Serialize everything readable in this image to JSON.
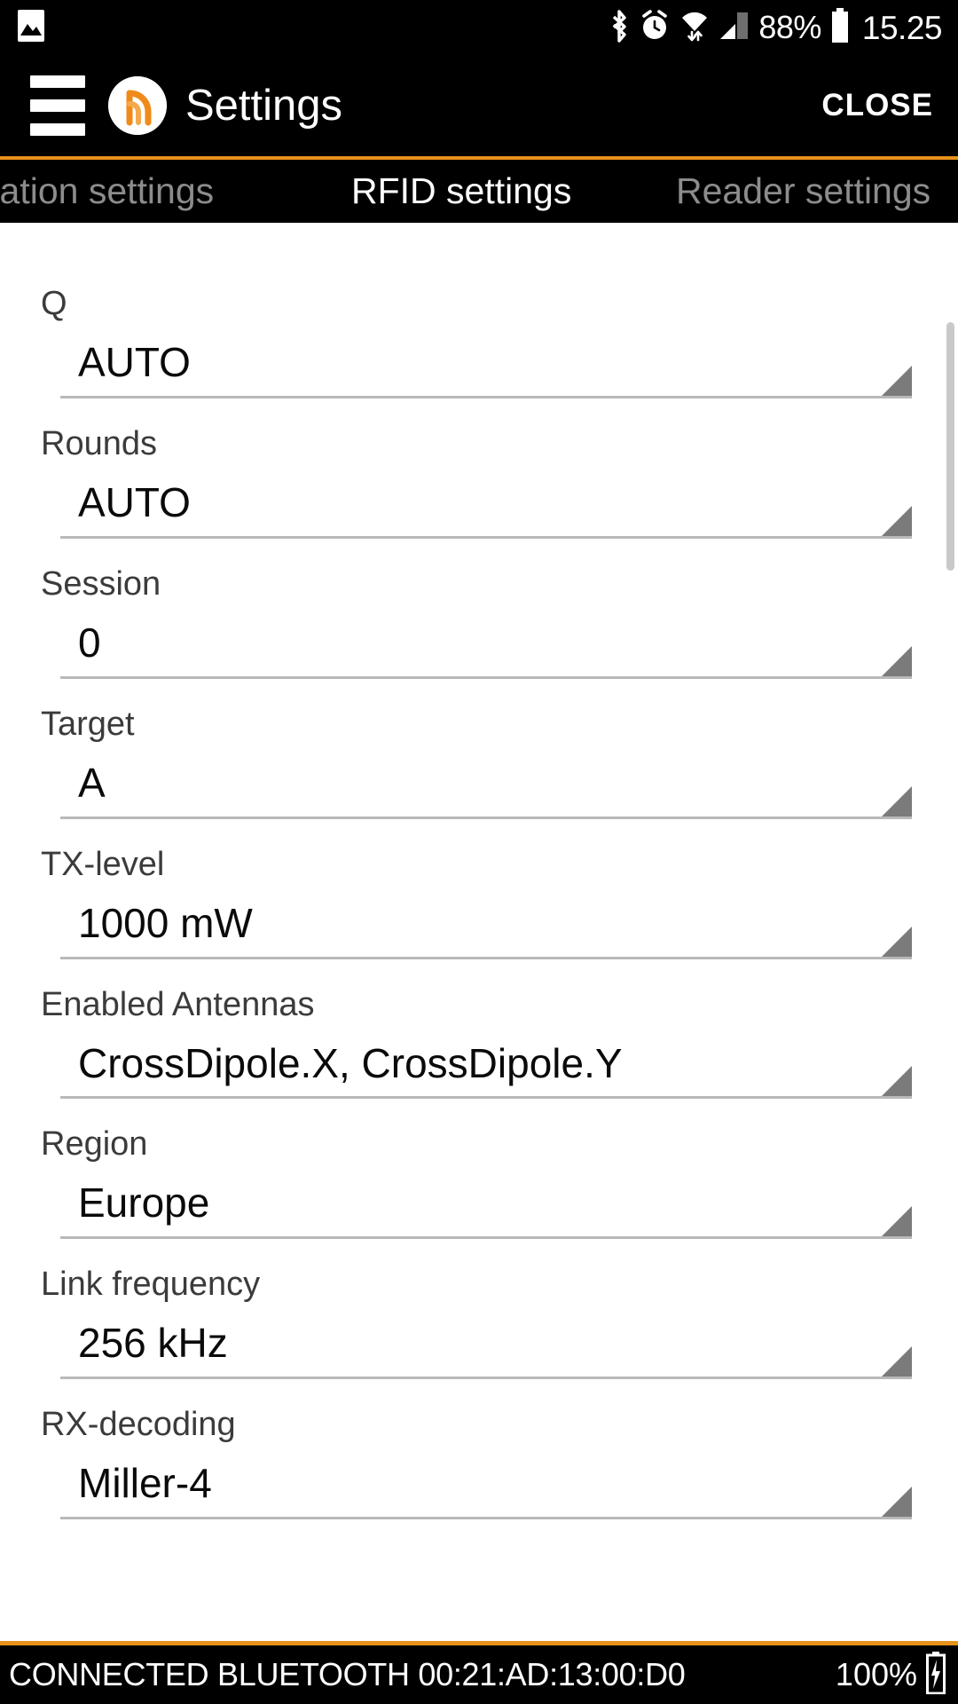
{
  "status_bar": {
    "icons": [
      "image-icon",
      "bluetooth-icon",
      "alarm-icon",
      "wifi-icon",
      "cell-signal-icon"
    ],
    "battery_percent": "88%",
    "clock": "15.25"
  },
  "header": {
    "menu_icon": "hamburger-menu-icon",
    "logo_icon": "rfid-waves-logo-icon",
    "title": "Settings",
    "close_label": "CLOSE"
  },
  "tabs": {
    "accent_color": "#E8911B",
    "items": [
      {
        "label": "plication settings",
        "active": false
      },
      {
        "label": "RFID settings",
        "active": true
      },
      {
        "label": "Reader settings",
        "active": false
      }
    ]
  },
  "settings": {
    "fields": [
      {
        "label": "Q",
        "value": "AUTO"
      },
      {
        "label": "Rounds",
        "value": "AUTO"
      },
      {
        "label": "Session",
        "value": "0"
      },
      {
        "label": "Target",
        "value": "A"
      },
      {
        "label": "TX-level",
        "value": "1000 mW"
      },
      {
        "label": "Enabled Antennas",
        "value": "CrossDipole.X, CrossDipole.Y"
      },
      {
        "label": "Region",
        "value": "Europe"
      },
      {
        "label": "Link frequency",
        "value": "256 kHz"
      },
      {
        "label": "RX-decoding",
        "value": "Miller-4"
      }
    ]
  },
  "bottom_bar": {
    "connection_text": "CONNECTED BLUETOOTH 00:21:AD:13:00:D0",
    "battery_percent": "100%",
    "battery_icon": "battery-icon"
  }
}
